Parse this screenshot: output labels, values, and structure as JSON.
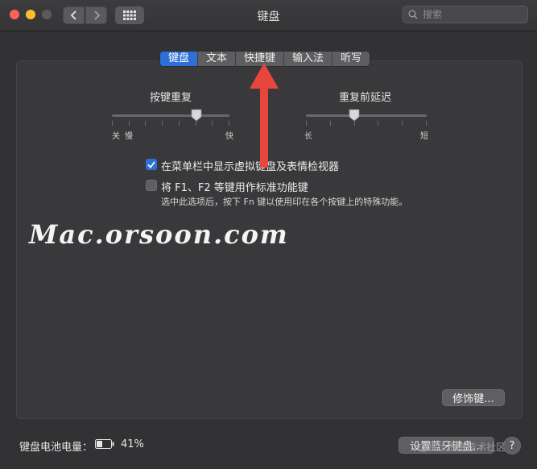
{
  "window": {
    "title": "键盘"
  },
  "search": {
    "placeholder": "搜索"
  },
  "tabs": [
    {
      "label": "键盘",
      "active": true
    },
    {
      "label": "文本",
      "active": false
    },
    {
      "label": "快捷键",
      "active": false
    },
    {
      "label": "输入法",
      "active": false
    },
    {
      "label": "听写",
      "active": false
    }
  ],
  "key_repeat": {
    "title": "按键重复",
    "label_off": "关",
    "label_slow": "慢",
    "label_fast": "快",
    "value_fraction": 0.72
  },
  "repeat_delay": {
    "title": "重复前延迟",
    "label_long": "长",
    "label_short": "短",
    "value_fraction": 0.4
  },
  "options": {
    "show_viewer": {
      "label": "在菜单栏中显示虚拟键盘及表情检视器",
      "checked": true
    },
    "fn_keys": {
      "label": "将 F1、F2 等键用作标准功能键",
      "checked": false,
      "description": "选中此选项后，按下 Fn 键以使用印在各个按键上的特殊功能。"
    }
  },
  "watermark": "Mac.orsoon.com",
  "buttons": {
    "modifier": "修饰键...",
    "bluetooth": "设置蓝牙键盘...",
    "help": "?"
  },
  "battery": {
    "label": "键盘电池电量：",
    "percent": "41%",
    "level": 0.41
  },
  "credit": "@稀土掘金技术社区",
  "colors": {
    "accent": "#2f6fd8",
    "arrow": "#e8453c"
  }
}
